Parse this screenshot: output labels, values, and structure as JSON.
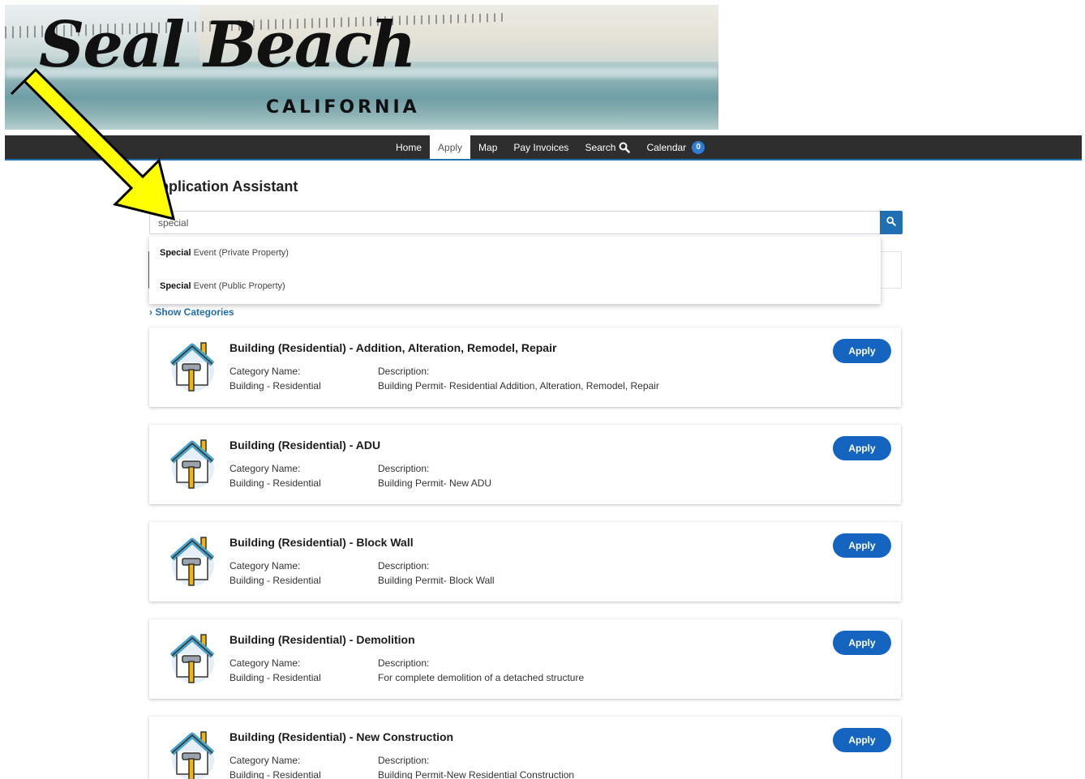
{
  "banner": {
    "logo_script": "Seal Beach",
    "logo_sub": "CALIFORNIA"
  },
  "nav": {
    "items": [
      {
        "label": "Home",
        "active": false
      },
      {
        "label": "Apply",
        "active": true
      },
      {
        "label": "Map",
        "active": false
      },
      {
        "label": "Pay Invoices",
        "active": false
      },
      {
        "label": "Search",
        "active": false
      },
      {
        "label": "Calendar",
        "active": false
      }
    ],
    "calendar_count": "0"
  },
  "page": {
    "title": "Application Assistant",
    "show_categories": "Show Categories"
  },
  "search": {
    "value": "special"
  },
  "suggestions": [
    {
      "match": "Special",
      "rest": " Event (Private Property)"
    },
    {
      "match": "Special",
      "rest": " Event (Public Property)"
    }
  ],
  "cards": [
    {
      "title": "Building (Residential) - Addition, Alteration, Remodel, Repair",
      "category_label": "Category Name:",
      "category_value": "Building - Residential",
      "description_label": "Description:",
      "description_value": "Building Permit- Residential Addition, Alteration, Remodel, Repair",
      "apply_label": "Apply"
    },
    {
      "title": "Building (Residential) - ADU",
      "category_label": "Category Name:",
      "category_value": "Building - Residential",
      "description_label": "Description:",
      "description_value": "Building Permit- New ADU",
      "apply_label": "Apply"
    },
    {
      "title": "Building (Residential) - Block Wall",
      "category_label": "Category Name:",
      "category_value": "Building - Residential",
      "description_label": "Description:",
      "description_value": "Building Permit- Block Wall",
      "apply_label": "Apply"
    },
    {
      "title": "Building (Residential) - Demolition",
      "category_label": "Category Name:",
      "category_value": "Building - Residential",
      "description_label": "Description:",
      "description_value": "For complete demolition of a detached structure",
      "apply_label": "Apply"
    },
    {
      "title": "Building (Residential) - New Construction",
      "category_label": "Category Name:",
      "category_value": "Building - Residential",
      "description_label": "Description:",
      "description_value": "Building Permit-New Residential Construction",
      "apply_label": "Apply"
    }
  ],
  "colors": {
    "nav_bg": "#2e2e2e",
    "accent": "#1f6fb2",
    "apply_btn": "#1565c0",
    "arrow_fill": "#ffff00"
  },
  "icons": {
    "search_button": "magnifier-icon",
    "card_icon": "house-hammer-icon",
    "overlay": "yellow-arrow-icon"
  }
}
